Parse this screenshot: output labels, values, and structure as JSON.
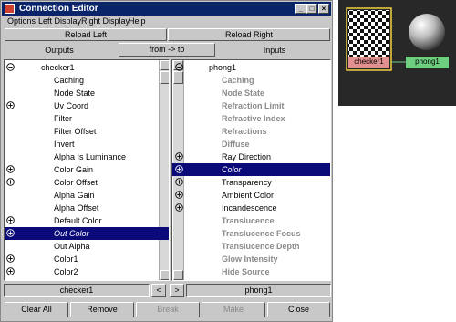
{
  "window": {
    "title": "Connection Editor",
    "min_glyph": "_",
    "max_glyph": "□",
    "close_glyph": "×"
  },
  "menu": [
    "Options",
    "Left Display",
    "Right Display",
    "Help"
  ],
  "reload": {
    "left": "Reload Left",
    "right": "Reload Right"
  },
  "header": {
    "outputs": "Outputs",
    "direction": "from -> to",
    "inputs": "Inputs"
  },
  "left_list": [
    {
      "label": "checker1",
      "expander": true,
      "indent": 0
    },
    {
      "label": "Caching",
      "expander": false,
      "indent": 1
    },
    {
      "label": "Node State",
      "expander": false,
      "indent": 1
    },
    {
      "label": "Uv Coord",
      "expander": true,
      "indent": 1
    },
    {
      "label": "Filter",
      "expander": false,
      "indent": 1
    },
    {
      "label": "Filter Offset",
      "expander": false,
      "indent": 1
    },
    {
      "label": "Invert",
      "expander": false,
      "indent": 1
    },
    {
      "label": "Alpha Is Luminance",
      "expander": false,
      "indent": 1
    },
    {
      "label": "Color Gain",
      "expander": true,
      "indent": 1
    },
    {
      "label": "Color Offset",
      "expander": true,
      "indent": 1
    },
    {
      "label": "Alpha Gain",
      "expander": false,
      "indent": 1
    },
    {
      "label": "Alpha Offset",
      "expander": false,
      "indent": 1
    },
    {
      "label": "Default Color",
      "expander": true,
      "indent": 1
    },
    {
      "label": "Out Color",
      "expander": true,
      "indent": 1,
      "selected": true
    },
    {
      "label": "Out Alpha",
      "expander": false,
      "indent": 1
    },
    {
      "label": "Color1",
      "expander": true,
      "indent": 1
    },
    {
      "label": "Color2",
      "expander": true,
      "indent": 1
    }
  ],
  "right_list": [
    {
      "label": "phong1",
      "expander": true,
      "indent": 0,
      "active": true
    },
    {
      "label": "Caching",
      "expander": false,
      "indent": 1
    },
    {
      "label": "Node State",
      "expander": false,
      "indent": 1
    },
    {
      "label": "Refraction Limit",
      "expander": false,
      "indent": 1
    },
    {
      "label": "Refractive Index",
      "expander": false,
      "indent": 1
    },
    {
      "label": "Refractions",
      "expander": false,
      "indent": 1
    },
    {
      "label": "Diffuse",
      "expander": false,
      "indent": 1
    },
    {
      "label": "Ray Direction",
      "expander": true,
      "indent": 1,
      "active": true
    },
    {
      "label": "Color",
      "expander": true,
      "indent": 1,
      "selected": true
    },
    {
      "label": "Transparency",
      "expander": true,
      "indent": 1,
      "active": true
    },
    {
      "label": "Ambient Color",
      "expander": true,
      "indent": 1,
      "active": true
    },
    {
      "label": "Incandescence",
      "expander": true,
      "indent": 1,
      "active": true
    },
    {
      "label": "Translucence",
      "expander": false,
      "indent": 1
    },
    {
      "label": "Translucence Focus",
      "expander": false,
      "indent": 1
    },
    {
      "label": "Translucence Depth",
      "expander": false,
      "indent": 1
    },
    {
      "label": "Glow Intensity",
      "expander": false,
      "indent": 1
    },
    {
      "label": "Hide Source",
      "expander": false,
      "indent": 1
    }
  ],
  "status": {
    "left": "checker1",
    "prev": "<",
    "next": ">",
    "right": "phong1"
  },
  "buttons": {
    "clear_all": "Clear All",
    "remove": "Remove",
    "break": "Break",
    "make": "Make",
    "close": "Close"
  },
  "hypergraph": {
    "node1": "checker1",
    "node2": "phong1",
    "node1_color": "#e39090",
    "node2_color": "#6fcf80",
    "selected_border": "#f0d040"
  },
  "colors": {
    "title_bg": "#0a246a",
    "selection_bg": "#0a0a78"
  }
}
